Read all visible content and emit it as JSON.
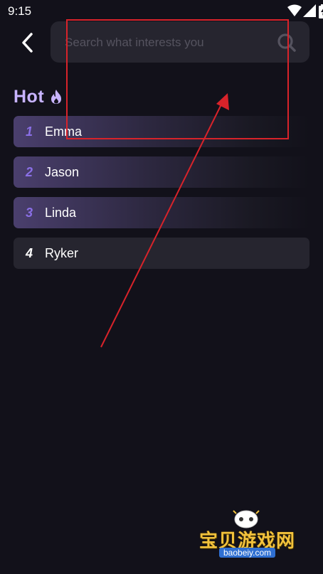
{
  "status_bar": {
    "time": "9:15",
    "icons": [
      "wifi-icon",
      "signal-icon",
      "battery-icon"
    ]
  },
  "header": {
    "back_icon": "back-arrow-icon",
    "search": {
      "placeholder": "Search what interests you",
      "value": "",
      "icon": "search-icon"
    }
  },
  "hot": {
    "title": "Hot",
    "icon": "flame-icon",
    "items": [
      {
        "rank": "1",
        "name": "Emma"
      },
      {
        "rank": "2",
        "name": "Jason"
      },
      {
        "rank": "3",
        "name": "Linda"
      },
      {
        "rank": "4",
        "name": "Ryker"
      }
    ]
  },
  "watermark": {
    "text": "宝贝游戏网",
    "url": "baobeiy.com"
  },
  "colors": {
    "background": "#12111a",
    "surface": "#26252f",
    "accent": "#c8b4ff",
    "rank_purple": "#8a6fe6",
    "annotation_red": "#d8232a"
  }
}
